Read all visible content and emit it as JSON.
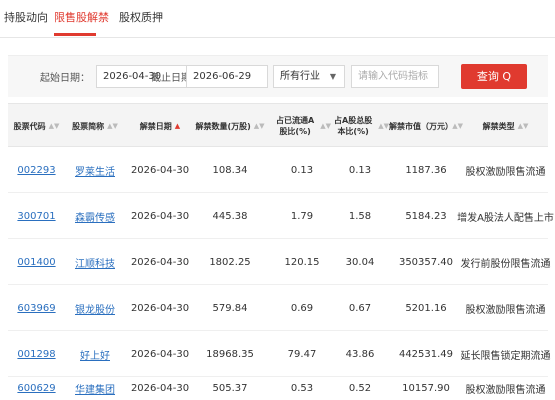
{
  "tabs": [
    {
      "label": "持股动向",
      "active": false
    },
    {
      "label": "限售股解禁",
      "active": true
    },
    {
      "label": "股权质押",
      "active": false
    }
  ],
  "filters": {
    "start_label": "起始日期：",
    "start_value": "2026-04-30",
    "end_label": "截止日期：",
    "end_value": "2026-06-29",
    "industry_value": "所有行业",
    "search_placeholder": "请输入代码指标",
    "query_label": "查询 Q"
  },
  "colors": {
    "accent": "#e03a2f",
    "link": "#2a6fbf"
  },
  "table": {
    "columns": [
      {
        "label": "股票代码",
        "sort": "both"
      },
      {
        "label": "股票简称",
        "sort": "both"
      },
      {
        "label": "解禁日期",
        "sort": "up-active"
      },
      {
        "label": "解禁数量(万股)",
        "sort": "both"
      },
      {
        "label": "占已流通A股比(%)",
        "sort": "both"
      },
      {
        "label": "占A股总股本比(%)",
        "sort": "both"
      },
      {
        "label": "解禁市值（万元）",
        "sort": "both"
      },
      {
        "label": "解禁类型",
        "sort": "both"
      }
    ],
    "rows": [
      {
        "code": "002293",
        "name": "罗莱生活",
        "date": "2026-04-30",
        "qty": "108.34",
        "float_pct": "0.13",
        "total_pct": "0.13",
        "value": "1187.36",
        "type": "股权激励限售流通"
      },
      {
        "code": "300701",
        "name": "森霸传感",
        "date": "2026-04-30",
        "qty": "445.38",
        "float_pct": "1.79",
        "total_pct": "1.58",
        "value": "5184.23",
        "type": "增发A股法人配售上市"
      },
      {
        "code": "001400",
        "name": "江顺科技",
        "date": "2026-04-30",
        "qty": "1802.25",
        "float_pct": "120.15",
        "total_pct": "30.04",
        "value": "350357.40",
        "type": "发行前股份限售流通"
      },
      {
        "code": "603969",
        "name": "银龙股份",
        "date": "2026-04-30",
        "qty": "579.84",
        "float_pct": "0.69",
        "total_pct": "0.67",
        "value": "5201.16",
        "type": "股权激励限售流通"
      },
      {
        "code": "001298",
        "name": "好上好",
        "date": "2026-04-30",
        "qty": "18968.35",
        "float_pct": "79.47",
        "total_pct": "43.86",
        "value": "442531.49",
        "type": "延长限售锁定期流通"
      },
      {
        "code": "600629",
        "name": "华建集团",
        "date": "2026-04-30",
        "qty": "505.37",
        "float_pct": "0.53",
        "total_pct": "0.52",
        "value": "10157.90",
        "type": "股权激励限售流通"
      }
    ]
  }
}
